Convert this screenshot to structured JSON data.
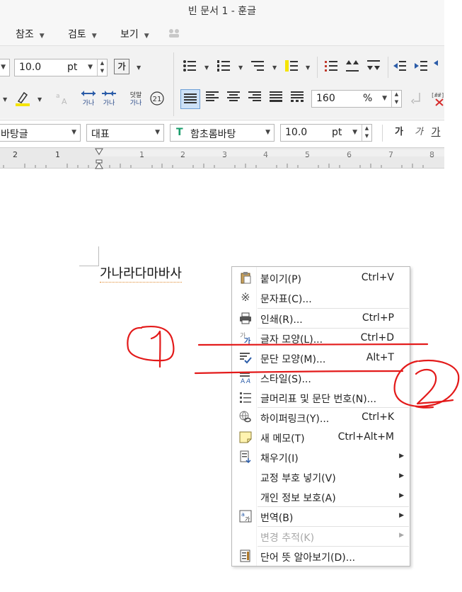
{
  "window": {
    "title": "빈 문서 1 - 훈글"
  },
  "menubar": {
    "items": [
      {
        "label": "참조"
      },
      {
        "label": "검토"
      },
      {
        "label": "보기"
      }
    ]
  },
  "toolbar": {
    "font_size": {
      "value": "10.0",
      "unit": "pt"
    },
    "char_icon": "가",
    "line_spacing": {
      "value": "160",
      "unit": "%"
    },
    "icon_label_gana": "가나",
    "icon_label_dotmal": "덧말",
    "icon_label_gana2": "가나",
    "circled_number": "21"
  },
  "formatbar": {
    "style": "바탕글",
    "lang": "대표",
    "font": "함초롬바탕",
    "font_icon": "T",
    "size": {
      "value": "10.0",
      "unit": "pt"
    },
    "bold_glyph": "가",
    "italic_glyph": "가",
    "underline_glyph": "가"
  },
  "ruler": {
    "labels": [
      "2",
      "1",
      "1",
      "2",
      "3",
      "4",
      "5",
      "6",
      "7",
      "8"
    ]
  },
  "document": {
    "text": "가나라다마바사"
  },
  "context_menu": {
    "items": [
      {
        "label": "붙이기(P)",
        "shortcut": "Ctrl+V",
        "icon": "clipboard-icon"
      },
      {
        "label": "문자표(C)...",
        "shortcut": "",
        "icon": "symbol-icon"
      },
      {
        "label": "인쇄(R)...",
        "shortcut": "Ctrl+P",
        "icon": "printer-icon"
      },
      {
        "label": "글자 모양(L)...",
        "shortcut": "Ctrl+D",
        "icon": "char-shape-icon"
      },
      {
        "label": "문단 모양(M)...",
        "shortcut": "Alt+T",
        "icon": "paragraph-shape-icon"
      },
      {
        "label": "스타일(S)...",
        "shortcut": "",
        "icon": "style-icon"
      },
      {
        "label": "글머리표 및 문단 번호(N)...",
        "shortcut": "",
        "icon": "bullets-icon"
      },
      {
        "label": "하이퍼링크(Y)...",
        "shortcut": "Ctrl+K",
        "icon": "hyperlink-icon"
      },
      {
        "label": "새 메모(T)",
        "shortcut": "Ctrl+Alt+M",
        "icon": "memo-icon"
      },
      {
        "label": "채우기(I)",
        "shortcut": "",
        "icon": "fill-icon"
      },
      {
        "label": "교정 부호 넣기(V)",
        "shortcut": "",
        "icon": ""
      },
      {
        "label": "개인 정보 보호(A)",
        "shortcut": "",
        "icon": ""
      },
      {
        "label": "번역(B)",
        "shortcut": "",
        "icon": "translate-icon"
      },
      {
        "label": "변경 추적(K)",
        "shortcut": "",
        "icon": ""
      },
      {
        "label": "단어 뜻 알아보기(D)...",
        "shortcut": "",
        "icon": "dictionary-icon"
      }
    ]
  },
  "colors": {
    "annotation": "#e31a1a",
    "selection": "#cde1f7",
    "highlight": "#f5e400"
  }
}
